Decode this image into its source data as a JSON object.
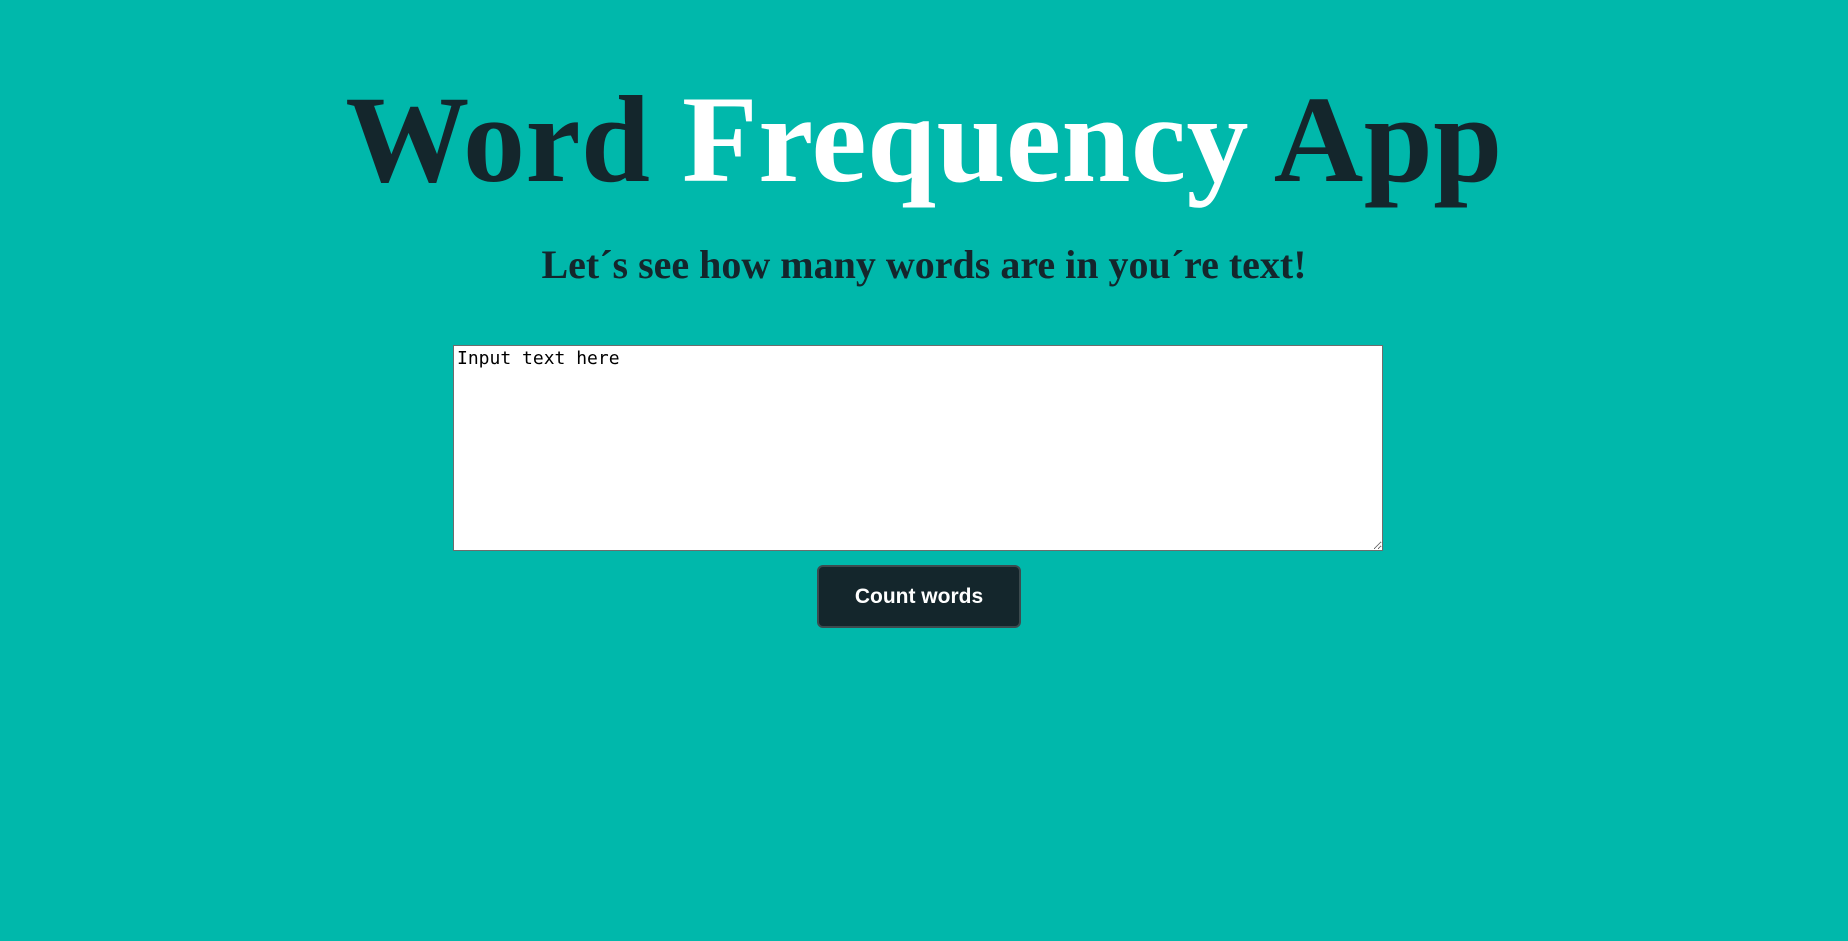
{
  "header": {
    "title_part1": "Word",
    "title_part2": "Frequency",
    "title_part3": "App",
    "subtitle": "Let´s see how many words are in you´re text!"
  },
  "form": {
    "textarea_placeholder": "Input text here",
    "textarea_value": "",
    "submit_label": "Count words"
  },
  "colors": {
    "background": "#00b8ab",
    "dark_text": "#14262c",
    "light_text": "#ffffff",
    "button_bg": "#14262c"
  }
}
